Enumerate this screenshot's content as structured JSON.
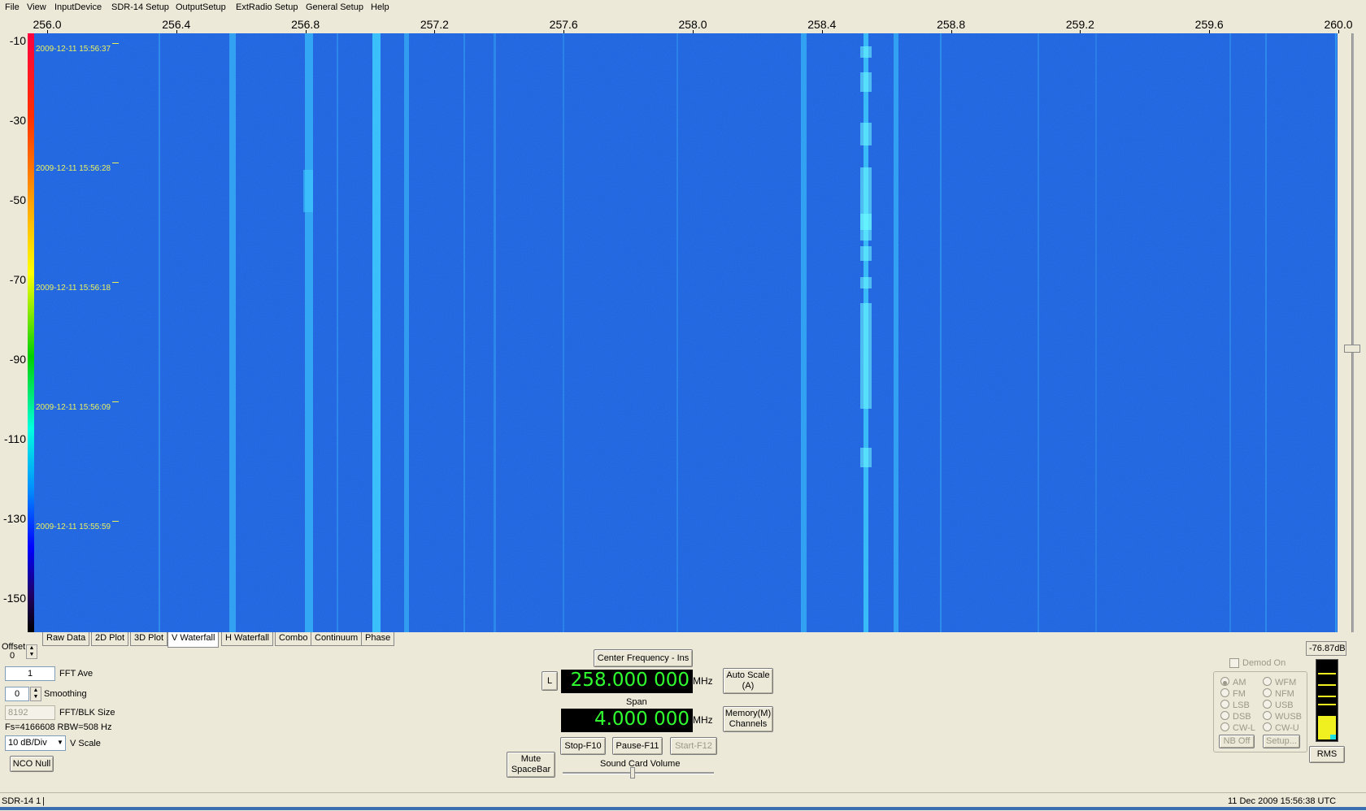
{
  "menu": [
    "File",
    "View",
    "InputDevice",
    "SDR-14 Setup",
    "OutputSetup",
    "ExtRadio Setup",
    "General Setup",
    "Help"
  ],
  "freq_axis": {
    "unit_range_mhz": [
      256.0,
      260.0
    ],
    "ticks": [
      "256.0",
      "256.4",
      "256.8",
      "257.2",
      "257.6",
      "258.0",
      "258.4",
      "258.8",
      "259.2",
      "259.6",
      "260.0"
    ]
  },
  "db_axis": {
    "ticks": [
      "-10",
      "-30",
      "-50",
      "-70",
      "-90",
      "-110",
      "-130",
      "-150"
    ]
  },
  "waterfall": {
    "timestamps": [
      "2009-12-11 15:56:37",
      "2009-12-11 15:56:28",
      "2009-12-11 15:56:18",
      "2009-12-11 15:56:09",
      "2009-12-11 15:55:59"
    ],
    "colors": {
      "background": "#1e5fd8",
      "signal": "#40d0ff",
      "strong": "#70ffff"
    }
  },
  "tabs": [
    "Raw Data",
    "2D Plot",
    "3D Plot",
    "V Waterfall",
    "H Waterfall",
    "Combo",
    "Continuum",
    "Phase"
  ],
  "active_tab": "V Waterfall",
  "controls": {
    "offset_label": "Offset",
    "offset_value": "0",
    "fft_ave_value": "1",
    "fft_ave_label": "FFT Ave",
    "smoothing_value": "0",
    "smoothing_label": "Smoothing",
    "fft_size_value": "8192",
    "fft_size_label": "FFT/BLK Size",
    "fs_text": "Fs=4166608 RBW=508 Hz",
    "vscale_value": "10 dB/Div",
    "vscale_label": "V Scale",
    "nco_null": "NCO Null"
  },
  "tuning": {
    "center_freq_button": "Center Frequency - Ins",
    "l_button": "L",
    "center_freq": "258.000 000",
    "mhz": "MHz",
    "auto_scale": "Auto Scale (A)",
    "span_label": "Span",
    "span": "4.000 000",
    "memory": "Memory(M) Channels",
    "stop": "Stop-F10",
    "pause": "Pause-F11",
    "start": "Start-F12",
    "mute": "Mute SpaceBar",
    "volume_label": "Sound Card Volume"
  },
  "demod": {
    "demod_on": "Demod On",
    "modes_left": [
      "AM",
      "FM",
      "LSB",
      "DSB",
      "CW-L"
    ],
    "modes_right": [
      "WFM",
      "NFM",
      "USB",
      "WUSB",
      "CW-U"
    ],
    "selected": "AM",
    "nb_off": "NB Off",
    "setup": "Setup..."
  },
  "meter": {
    "level": "-76.87dB",
    "fill_fraction": 0.3,
    "rms": "RMS"
  },
  "status": {
    "left": "SDR-14 1",
    "right": "11 Dec 2009  15:56:38 UTC"
  }
}
